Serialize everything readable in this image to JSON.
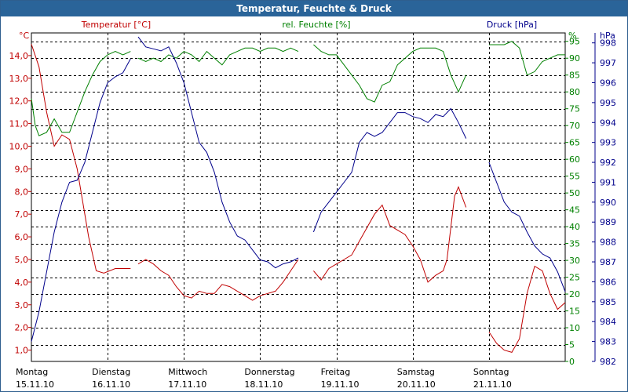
{
  "chart_data": {
    "type": "line",
    "title": "Temperatur, Feuchte & Druck",
    "x_ticks": [
      {
        "day": "Montag",
        "date": "15.11.10"
      },
      {
        "day": "Dienstag",
        "date": "16.11.10"
      },
      {
        "day": "Mittwoch",
        "date": "17.11.10"
      },
      {
        "day": "Donnerstag",
        "date": "18.11.10"
      },
      {
        "day": "Freitag",
        "date": "19.11.10"
      },
      {
        "day": "Samstag",
        "date": "20.11.10"
      },
      {
        "day": "Sonntag",
        "date": "21.11.10"
      }
    ],
    "x_range_days": [
      0,
      7
    ],
    "grid": true,
    "axes": {
      "temperature": {
        "label": "Temperatur [°C]",
        "unit": "°C",
        "min": 0.5,
        "max": 15,
        "ticks": [
          "1,0",
          "2,0",
          "3,0",
          "4,0",
          "5,0",
          "6,0",
          "7,0",
          "8,0",
          "9,0",
          "10,0",
          "11,0",
          "12,0",
          "13,0",
          "14,0"
        ],
        "tick_values": [
          1,
          2,
          3,
          4,
          5,
          6,
          7,
          8,
          9,
          10,
          11,
          12,
          13,
          14
        ],
        "color": "#C00000"
      },
      "humidity": {
        "label": "rel. Feuchte [%]",
        "unit": "%",
        "min": 0,
        "max": 97.5,
        "ticks": [
          "0",
          "5",
          "10",
          "15",
          "20",
          "25",
          "30",
          "35",
          "40",
          "45",
          "50",
          "55",
          "60",
          "65",
          "70",
          "75",
          "80",
          "85",
          "90",
          "95"
        ],
        "tick_values": [
          0,
          5,
          10,
          15,
          20,
          25,
          30,
          35,
          40,
          45,
          50,
          55,
          60,
          65,
          70,
          75,
          80,
          85,
          90,
          95
        ],
        "color": "#008000"
      },
      "pressure": {
        "label": "Druck [hPa]",
        "unit": "hPa",
        "min": 982,
        "max": 998.5,
        "ticks": [
          "982",
          "983",
          "984",
          "985",
          "986",
          "987",
          "988",
          "989",
          "990",
          "991",
          "992",
          "993",
          "994",
          "995",
          "996",
          "997",
          "998"
        ],
        "tick_values": [
          982,
          983,
          984,
          985,
          986,
          987,
          988,
          989,
          990,
          991,
          992,
          993,
          994,
          995,
          996,
          997,
          998
        ],
        "color": "#00008B"
      }
    },
    "series": [
      {
        "name": "Temperatur [°C]",
        "axis": "temperature",
        "color": "#C00000",
        "segments": [
          [
            [
              0,
              14.5
            ],
            [
              0.1,
              13.5
            ],
            [
              0.2,
              11.5
            ],
            [
              0.3,
              10.0
            ],
            [
              0.4,
              10.5
            ],
            [
              0.5,
              10.3
            ],
            [
              0.6,
              9.0
            ],
            [
              0.75,
              6.0
            ],
            [
              0.85,
              4.5
            ],
            [
              0.95,
              4.4
            ],
            [
              1.1,
              4.6
            ],
            [
              1.2,
              4.6
            ],
            [
              1.3,
              4.6
            ]
          ],
          [
            [
              1.4,
              4.8
            ],
            [
              1.5,
              5.0
            ],
            [
              1.6,
              4.8
            ],
            [
              1.7,
              4.5
            ],
            [
              1.8,
              4.3
            ],
            [
              1.9,
              3.8
            ],
            [
              2.0,
              3.4
            ],
            [
              2.1,
              3.3
            ],
            [
              2.2,
              3.6
            ],
            [
              2.3,
              3.5
            ],
            [
              2.4,
              3.5
            ],
            [
              2.5,
              3.9
            ],
            [
              2.6,
              3.8
            ],
            [
              2.7,
              3.6
            ],
            [
              2.8,
              3.4
            ],
            [
              2.9,
              3.2
            ],
            [
              3.0,
              3.4
            ],
            [
              3.1,
              3.5
            ],
            [
              3.2,
              3.6
            ],
            [
              3.3,
              4.0
            ],
            [
              3.4,
              4.5
            ],
            [
              3.5,
              5.0
            ]
          ],
          [
            [
              3.7,
              4.5
            ],
            [
              3.8,
              4.1
            ],
            [
              3.9,
              4.6
            ],
            [
              4.0,
              4.8
            ],
            [
              4.1,
              5.0
            ],
            [
              4.2,
              5.2
            ],
            [
              4.3,
              5.8
            ],
            [
              4.4,
              6.4
            ],
            [
              4.5,
              7.0
            ],
            [
              4.6,
              7.4
            ],
            [
              4.7,
              6.5
            ],
            [
              4.8,
              6.3
            ],
            [
              4.9,
              6.1
            ],
            [
              5.0,
              5.6
            ],
            [
              5.1,
              5.0
            ],
            [
              5.2,
              4.0
            ],
            [
              5.3,
              4.3
            ],
            [
              5.4,
              4.5
            ],
            [
              5.45,
              5.0
            ],
            [
              5.55,
              7.8
            ],
            [
              5.6,
              8.2
            ],
            [
              5.7,
              7.3
            ]
          ],
          [
            [
              6.0,
              1.8
            ],
            [
              6.1,
              1.3
            ],
            [
              6.2,
              1.0
            ],
            [
              6.3,
              0.9
            ],
            [
              6.4,
              1.5
            ],
            [
              6.5,
              3.5
            ],
            [
              6.6,
              4.7
            ],
            [
              6.7,
              4.5
            ],
            [
              6.8,
              3.5
            ],
            [
              6.9,
              2.8
            ],
            [
              7.0,
              3.1
            ]
          ]
        ]
      },
      {
        "name": "rel. Feuchte [%]",
        "axis": "humidity",
        "color": "#008000",
        "segments": [
          [
            [
              0,
              78
            ],
            [
              0.05,
              70
            ],
            [
              0.1,
              67
            ],
            [
              0.2,
              68
            ],
            [
              0.3,
              72
            ],
            [
              0.4,
              68
            ],
            [
              0.5,
              68
            ],
            [
              0.6,
              74
            ],
            [
              0.7,
              80
            ],
            [
              0.8,
              85
            ],
            [
              0.9,
              89
            ],
            [
              1.0,
              91
            ],
            [
              1.1,
              92
            ],
            [
              1.2,
              91
            ],
            [
              1.3,
              92
            ]
          ],
          [
            [
              1.4,
              90
            ],
            [
              1.5,
              89
            ],
            [
              1.6,
              90
            ],
            [
              1.7,
              89
            ],
            [
              1.8,
              91
            ],
            [
              1.9,
              90
            ],
            [
              2.0,
              92
            ],
            [
              2.1,
              91
            ],
            [
              2.2,
              89
            ],
            [
              2.3,
              92
            ],
            [
              2.4,
              90
            ],
            [
              2.5,
              88
            ],
            [
              2.6,
              91
            ],
            [
              2.7,
              92
            ],
            [
              2.8,
              93
            ],
            [
              2.9,
              93
            ],
            [
              3.0,
              92
            ],
            [
              3.1,
              93
            ],
            [
              3.2,
              93
            ],
            [
              3.3,
              92
            ],
            [
              3.4,
              93
            ],
            [
              3.5,
              92
            ]
          ],
          [
            [
              3.7,
              94
            ],
            [
              3.8,
              92
            ],
            [
              3.9,
              91
            ],
            [
              4.0,
              91
            ],
            [
              4.1,
              88
            ],
            [
              4.2,
              85
            ],
            [
              4.3,
              82
            ],
            [
              4.4,
              78
            ],
            [
              4.5,
              77
            ],
            [
              4.6,
              82
            ],
            [
              4.7,
              83
            ],
            [
              4.8,
              88
            ],
            [
              4.9,
              90
            ],
            [
              5.0,
              92
            ],
            [
              5.1,
              93
            ],
            [
              5.2,
              93
            ],
            [
              5.3,
              93
            ],
            [
              5.4,
              92
            ],
            [
              5.5,
              85
            ],
            [
              5.6,
              80
            ],
            [
              5.7,
              85
            ]
          ],
          [
            [
              6.0,
              94
            ],
            [
              6.1,
              94
            ],
            [
              6.2,
              94
            ],
            [
              6.3,
              95
            ],
            [
              6.4,
              93
            ],
            [
              6.5,
              85
            ],
            [
              6.6,
              86
            ],
            [
              6.7,
              89
            ],
            [
              6.8,
              90
            ],
            [
              6.9,
              91
            ],
            [
              7.0,
              91
            ]
          ]
        ]
      },
      {
        "name": "Druck [hPa]",
        "axis": "pressure",
        "color": "#00008B",
        "segments": [
          [
            [
              0,
              983
            ],
            [
              0.1,
              984.5
            ],
            [
              0.2,
              986.5
            ],
            [
              0.3,
              988.5
            ],
            [
              0.4,
              990.0
            ],
            [
              0.5,
              991.0
            ],
            [
              0.6,
              991.1
            ],
            [
              0.7,
              992.0
            ],
            [
              0.8,
              993.5
            ],
            [
              0.9,
              995.0
            ],
            [
              1.0,
              996.0
            ],
            [
              1.1,
              996.3
            ],
            [
              1.2,
              996.5
            ],
            [
              1.3,
              997.2
            ]
          ],
          [
            [
              1.4,
              998.3
            ],
            [
              1.5,
              997.8
            ],
            [
              1.6,
              997.7
            ],
            [
              1.7,
              997.6
            ],
            [
              1.8,
              997.8
            ],
            [
              1.9,
              997.0
            ],
            [
              2.0,
              996.0
            ],
            [
              2.1,
              994.5
            ],
            [
              2.2,
              993.0
            ],
            [
              2.3,
              992.5
            ],
            [
              2.4,
              991.5
            ],
            [
              2.5,
              990.0
            ],
            [
              2.6,
              989.0
            ],
            [
              2.7,
              988.3
            ],
            [
              2.8,
              988.1
            ],
            [
              2.9,
              987.6
            ],
            [
              3.0,
              987.1
            ],
            [
              3.1,
              987.0
            ],
            [
              3.2,
              986.7
            ],
            [
              3.3,
              986.9
            ],
            [
              3.4,
              987.0
            ],
            [
              3.5,
              987.2
            ]
          ],
          [
            [
              3.7,
              988.5
            ],
            [
              3.8,
              989.5
            ],
            [
              3.9,
              990.0
            ],
            [
              4.0,
              990.5
            ],
            [
              4.1,
              991.0
            ],
            [
              4.2,
              991.5
            ],
            [
              4.3,
              993.0
            ],
            [
              4.4,
              993.5
            ],
            [
              4.5,
              993.3
            ],
            [
              4.6,
              993.5
            ],
            [
              4.7,
              994.0
            ],
            [
              4.8,
              994.5
            ],
            [
              4.9,
              994.5
            ],
            [
              5.0,
              994.3
            ],
            [
              5.1,
              994.2
            ],
            [
              5.2,
              994.0
            ],
            [
              5.3,
              994.4
            ],
            [
              5.4,
              994.3
            ],
            [
              5.5,
              994.7
            ],
            [
              5.6,
              994.0
            ],
            [
              5.7,
              993.2
            ]
          ],
          [
            [
              6.0,
              992.0
            ],
            [
              6.1,
              991.0
            ],
            [
              6.2,
              990.0
            ],
            [
              6.3,
              989.5
            ],
            [
              6.4,
              989.3
            ],
            [
              6.5,
              988.5
            ],
            [
              6.6,
              987.8
            ],
            [
              6.7,
              987.4
            ],
            [
              6.8,
              987.2
            ],
            [
              6.9,
              986.5
            ],
            [
              7.0,
              985.5
            ]
          ]
        ]
      }
    ]
  }
}
